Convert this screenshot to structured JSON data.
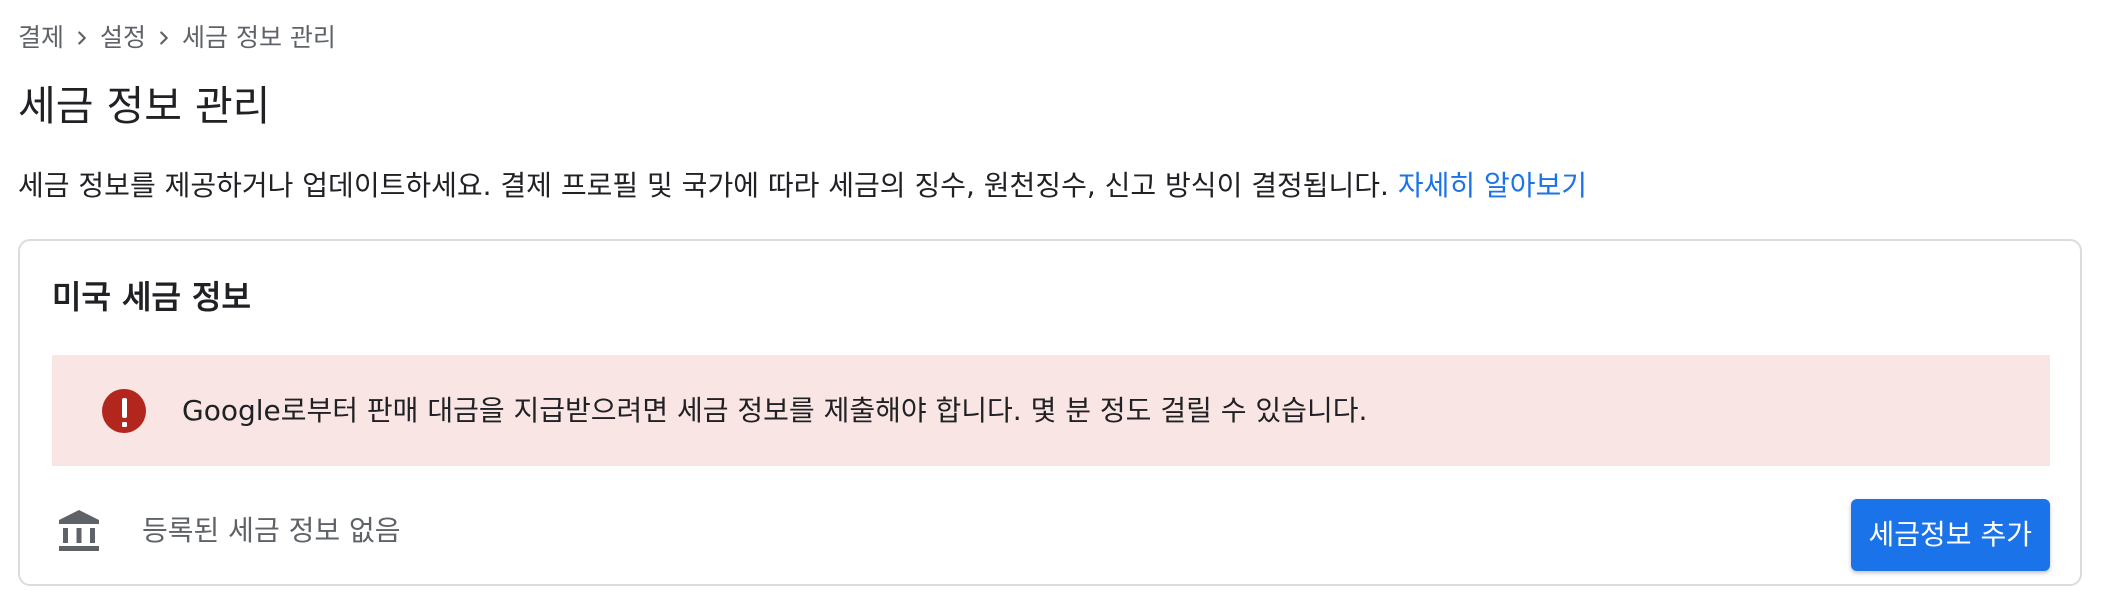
{
  "breadcrumb": {
    "items": [
      "결제",
      "설정",
      "세금 정보 관리"
    ]
  },
  "page": {
    "title": "세금 정보 관리",
    "description": "세금 정보를 제공하거나 업데이트하세요. 결제 프로필 및 국가에 따라 세금의 징수, 원천징수, 신고 방식이 결정됩니다.",
    "learn_more_link": "자세히 알아보기"
  },
  "card": {
    "title": "미국 세금 정보",
    "alert": {
      "icon": "error-icon",
      "text": "Google로부터 판매 대금을 지급받으려면 세금 정보를 제출해야 합니다. 몇 분 정도 걸릴 수 있습니다."
    },
    "empty_state": {
      "icon": "bank-icon",
      "text": "등록된 세금 정보 없음"
    },
    "add_button_label": "세금정보 추가"
  },
  "colors": {
    "accent": "#1a73e8",
    "alert_background": "#f9e6e4",
    "error": "#b3261e",
    "secondary_text": "#5f6368",
    "border": "#dadce0"
  }
}
